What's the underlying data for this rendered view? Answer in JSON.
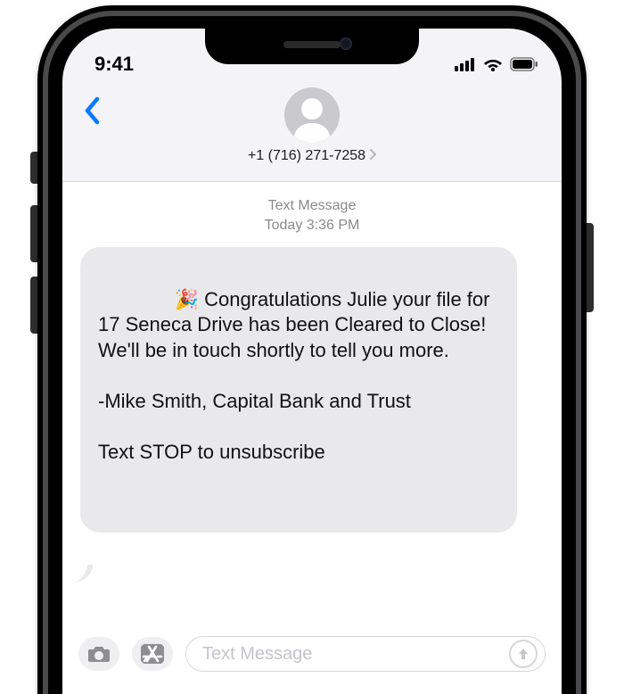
{
  "status": {
    "time": "9:41"
  },
  "header": {
    "contact_number": "+1 (716) 271-7258"
  },
  "thread": {
    "meta_label": "Text Message",
    "meta_day": "Today",
    "meta_time": "3:36 PM",
    "message_text": "🎉 Congratulations Julie your file for 17 Seneca Drive has been Cleared to Close! We'll be in touch shortly to tell you more.\n\n-Mike Smith, Capital Bank and Trust\n\nText STOP to unsubscribe"
  },
  "compose": {
    "placeholder": "Text Message"
  }
}
